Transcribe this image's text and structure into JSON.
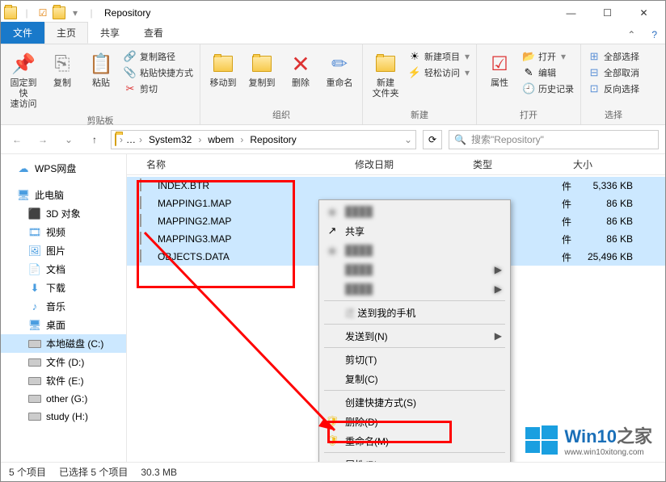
{
  "titlebar": {
    "title": "Repository"
  },
  "tabs": {
    "file": "文件",
    "home": "主页",
    "share": "共享",
    "view": "查看"
  },
  "ribbon": {
    "clipboard": {
      "label": "剪贴板",
      "pin": "固定到快\n速访问",
      "copy": "复制",
      "paste": "粘贴",
      "copypath": "复制路径",
      "pasteshortcut": "粘贴快捷方式",
      "cut": "剪切"
    },
    "organize": {
      "label": "组织",
      "moveto": "移动到",
      "copyto": "复制到",
      "delete": "删除",
      "rename": "重命名"
    },
    "new": {
      "label": "新建",
      "newfolder": "新建\n文件夹",
      "newitem": "新建项目",
      "easyaccess": "轻松访问"
    },
    "open": {
      "label": "打开",
      "properties": "属性",
      "open": "打开",
      "edit": "编辑",
      "history": "历史记录"
    },
    "select": {
      "label": "选择",
      "selectall": "全部选择",
      "selectnone": "全部取消",
      "invert": "反向选择"
    }
  },
  "breadcrumb": {
    "seg1": "System32",
    "seg2": "wbem",
    "seg3": "Repository"
  },
  "search": {
    "placeholder": "搜索\"Repository\""
  },
  "sidebar": {
    "wps": "WPS网盘",
    "thispc": "此电脑",
    "objects3d": "3D 对象",
    "videos": "视频",
    "pictures": "图片",
    "documents": "文档",
    "downloads": "下载",
    "music": "音乐",
    "desktop": "桌面",
    "diskc": "本地磁盘 (C:)",
    "diskd": "文件 (D:)",
    "diske": "软件 (E:)",
    "diskg": "other (G:)",
    "diskh": "study (H:)"
  },
  "columns": {
    "name": "名称",
    "date": "修改日期",
    "type": "类型",
    "size": "大小"
  },
  "files": [
    {
      "name": "INDEX.BTR",
      "size": "5,336 KB"
    },
    {
      "name": "MAPPING1.MAP",
      "size": "86 KB"
    },
    {
      "name": "MAPPING2.MAP",
      "size": "86 KB"
    },
    {
      "name": "MAPPING3.MAP",
      "size": "86 KB"
    },
    {
      "name": "OBJECTS.DATA",
      "size": "25,496 KB"
    }
  ],
  "contextmenu": {
    "share": "共享",
    "sendtophone": "送到我的手机",
    "sendto": "发送到(N)",
    "cut": "剪切(T)",
    "copy": "复制(C)",
    "createshortcut": "创建快捷方式(S)",
    "delete": "删除(D)",
    "rename": "重命名(M)",
    "properties": "属性(R)"
  },
  "statusbar": {
    "items": "5 个项目",
    "selected": "已选择 5 个项目",
    "size": "30.3 MB"
  },
  "watermark": {
    "brand": "Win10",
    "suffix": "之家",
    "url": "www.win10xitong.com"
  },
  "file_type_suffix": "件"
}
